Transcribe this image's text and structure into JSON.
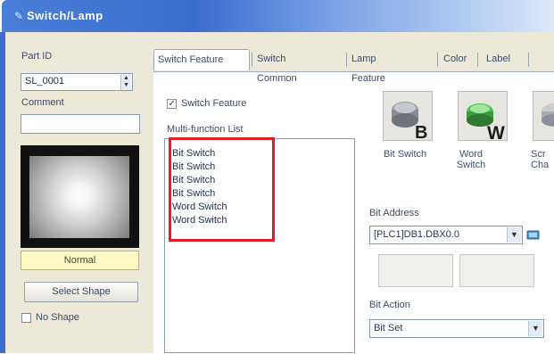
{
  "window": {
    "title": "Switch/Lamp"
  },
  "left": {
    "part_id_label": "Part ID",
    "part_id_value": "SL_0001",
    "comment_label": "Comment",
    "comment_value": "",
    "state_label": "Normal",
    "select_shape_label": "Select Shape",
    "no_shape_label": "No Shape"
  },
  "tabs": [
    {
      "label": "Switch Feature"
    },
    {
      "label": "Switch Common"
    },
    {
      "label": "Lamp Feature"
    },
    {
      "label": "Color"
    },
    {
      "label": "Label"
    }
  ],
  "switch_feature": {
    "checkbox_label": "Switch Feature",
    "checked": true,
    "list_label": "Multi-function List",
    "items": [
      "Bit Switch",
      "Bit Switch",
      "Bit Switch",
      "Bit Switch",
      "Word Switch",
      "Word Switch"
    ]
  },
  "tools": [
    {
      "icon": "bit-switch-icon",
      "label1": "Bit Switch",
      "label2": ""
    },
    {
      "icon": "word-switch-icon",
      "label1": "Word",
      "label2": "Switch"
    },
    {
      "icon": "screen-change-icon",
      "label1": "Scr",
      "label2": "Cha"
    }
  ],
  "bit_address": {
    "label": "Bit Address",
    "value": "[PLC1]DB1.DBX0.0"
  },
  "bit_action": {
    "label": "Bit Action",
    "value": "Bit Set"
  },
  "colors": {
    "highlight": "#e01e2a",
    "title_bar": "#3a6ccf"
  }
}
